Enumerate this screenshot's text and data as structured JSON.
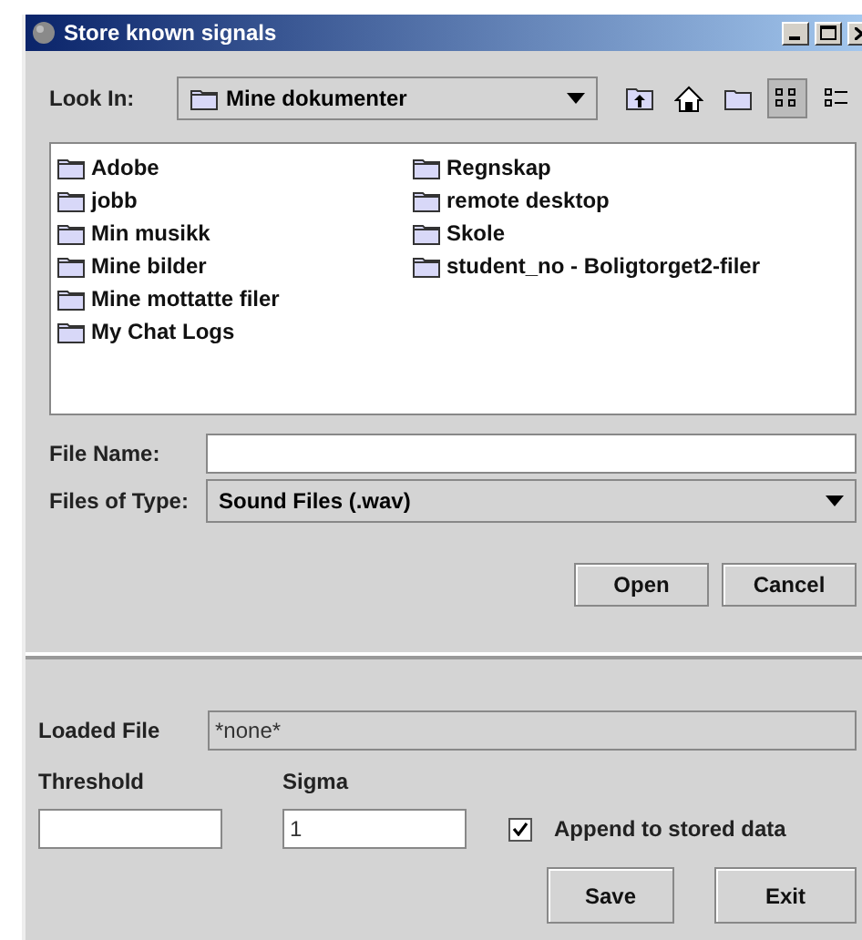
{
  "window": {
    "title": "Store known signals"
  },
  "look_in": {
    "label": "Look In:",
    "value": "Mine dokumenter"
  },
  "files": [
    {
      "name": "Adobe"
    },
    {
      "name": "jobb"
    },
    {
      "name": "Min musikk"
    },
    {
      "name": "Mine bilder"
    },
    {
      "name": "Mine mottatte filer"
    },
    {
      "name": "My Chat Logs"
    },
    {
      "name": "Regnskap"
    },
    {
      "name": "remote desktop"
    },
    {
      "name": "Skole"
    },
    {
      "name": "student_no - Boligtorget2-filer"
    }
  ],
  "file_name": {
    "label": "File Name:"
  },
  "files_of_type": {
    "label": "Files of Type:",
    "value": "Sound Files (.wav)"
  },
  "chooser_buttons": [
    "Open",
    "Cancel"
  ],
  "loaded_file": {
    "label": "Loaded File",
    "value": "*none*"
  },
  "threshold": {
    "label": "Threshold"
  },
  "sigma": {
    "label": "Sigma",
    "value": "1"
  },
  "append": {
    "label": "Append to stored data",
    "checked": true
  },
  "buttons": [
    "Save",
    "Exit"
  ]
}
